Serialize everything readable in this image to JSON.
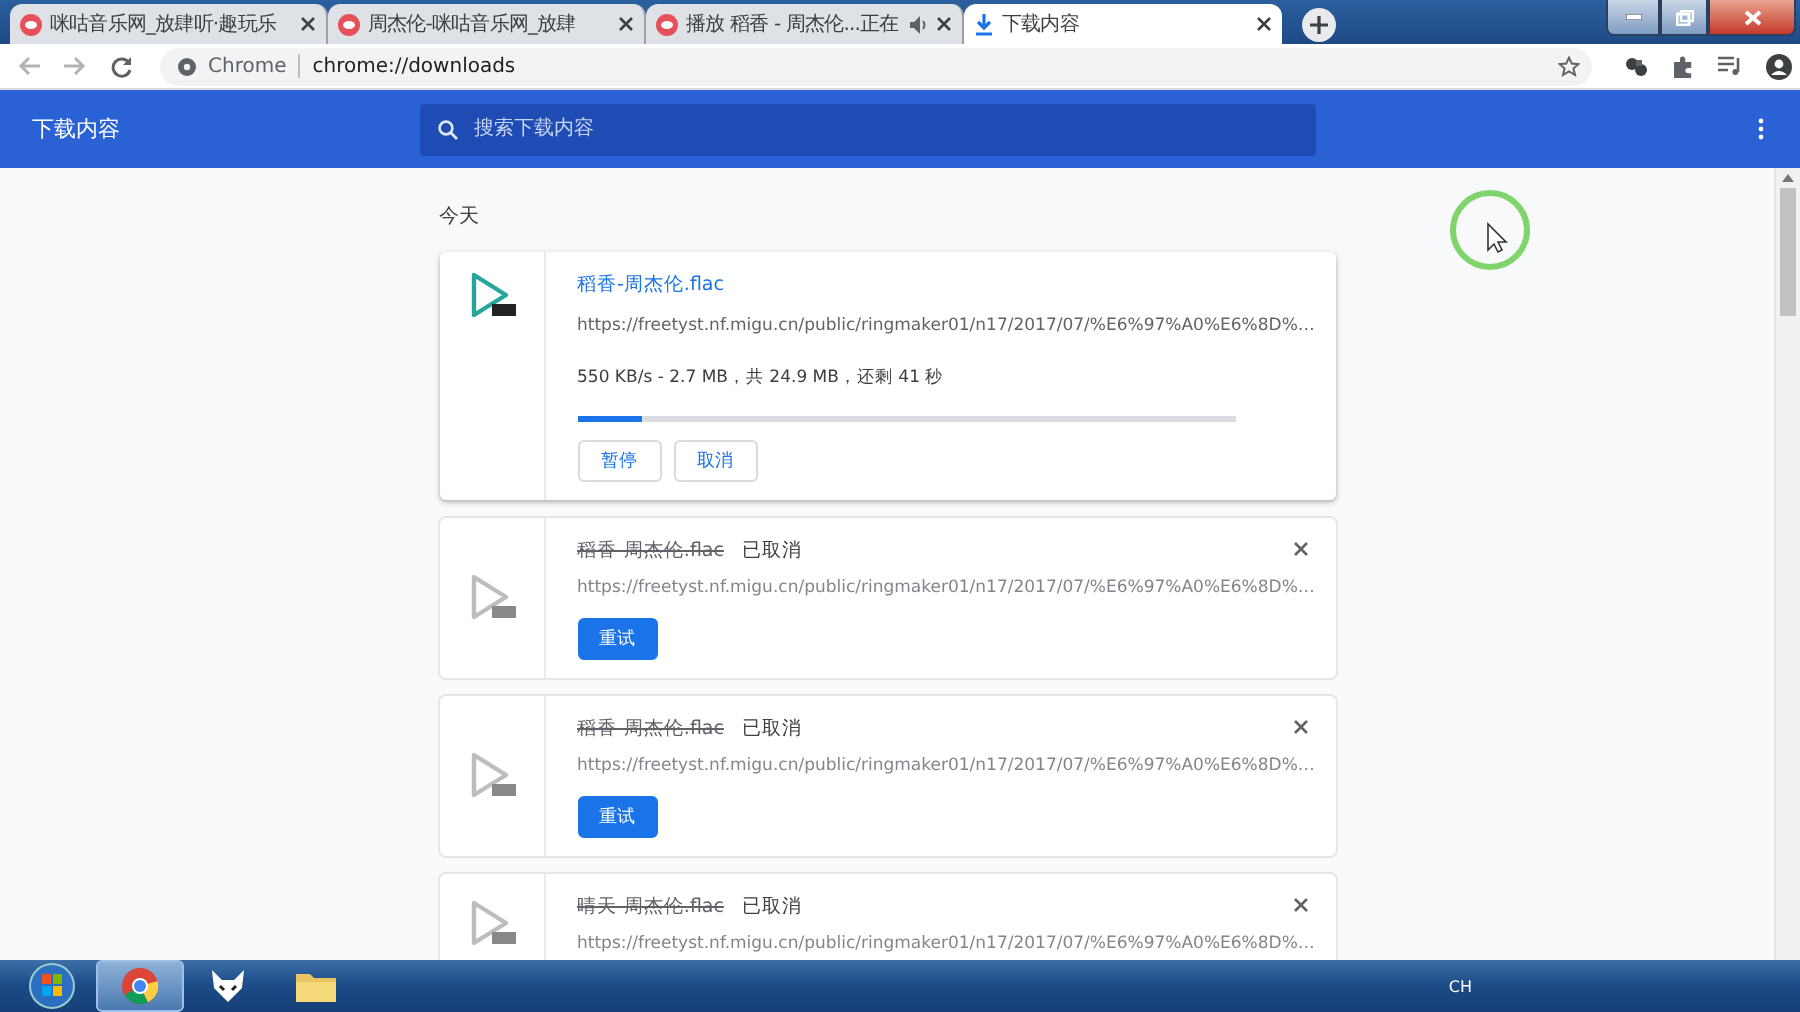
{
  "tabs": [
    {
      "title": "咪咕音乐网_放肆听·趣玩乐",
      "selected": false,
      "audio": false
    },
    {
      "title": "周杰伦-咪咕音乐网_放肆",
      "selected": false,
      "audio": false
    },
    {
      "title": "播放 稻香 - 周杰伦...正在",
      "selected": false,
      "audio": true
    },
    {
      "title": "下载内容",
      "selected": true,
      "audio": false
    }
  ],
  "omnibox": {
    "site_label": "Chrome",
    "url": "chrome://downloads"
  },
  "header": {
    "title": "下载内容",
    "search": {
      "placeholder": "搜索下载内容"
    }
  },
  "section": "今天",
  "downloads": [
    {
      "kind": "active",
      "name": "稻香-周杰伦.flac",
      "url": "https://freetyst.nf.migu.cn/public/ringmaker01/n17/2017/07/%E6%97%A0%E6%8D%…",
      "status": "550 KB/s - 2.7 MB，共 24.9 MB，还剩 41 秒",
      "level": 0.1,
      "buttons": [
        "暂停",
        "取消"
      ]
    },
    {
      "kind": "cancelled",
      "name": "稻香-周杰伦.flac",
      "state": "已取消",
      "url": "https://freetyst.nf.migu.cn/public/ringmaker01/n17/2017/07/%E6%97%A0%E6%8D%…",
      "buttons": [
        "重试"
      ]
    },
    {
      "kind": "cancelled",
      "name": "稻香-周杰伦.flac",
      "state": "已取消",
      "url": "https://freetyst.nf.migu.cn/public/ringmaker01/n17/2017/07/%E6%97%A0%E6%8D%…",
      "buttons": [
        "重试"
      ]
    },
    {
      "kind": "cancelled",
      "name": "晴天-周杰伦.flac",
      "state": "已取消",
      "url": "https://freetyst.nf.migu.cn/public/ringmaker01/n17/2017/07/%E6%97%A0%E6%8D%…"
    }
  ],
  "taskbar": {
    "language": "CH"
  }
}
